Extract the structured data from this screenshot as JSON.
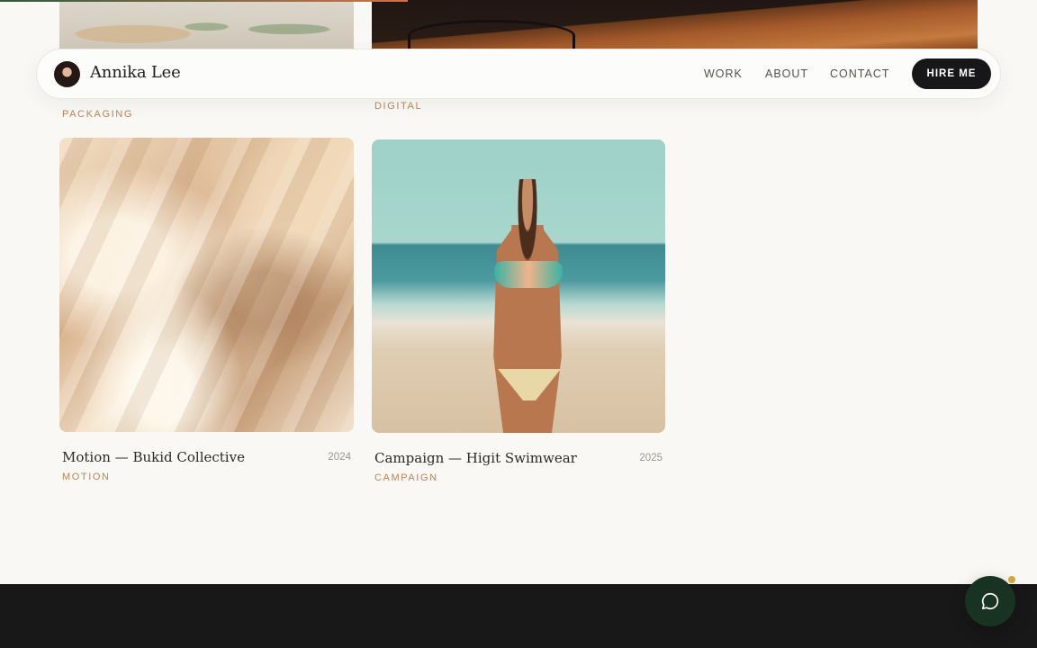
{
  "nav": {
    "brand": "Annika Lee",
    "links": [
      "WORK",
      "ABOUT",
      "CONTACT"
    ],
    "cta": "HIRE ME"
  },
  "partial_cards": [
    {
      "tag": "PACKAGING"
    },
    {
      "tag": "DIGITAL"
    }
  ],
  "cards": [
    {
      "title": "Motion — Bukid Collective",
      "year": "2024",
      "tag": "MOTION"
    },
    {
      "title": "Campaign — Higit Swimwear",
      "year": "2025",
      "tag": "CAMPAIGN"
    }
  ],
  "colors": {
    "accent": "#b98558",
    "button": "#17171a",
    "chat": "#183321",
    "footer": "#181818",
    "notification": "#d4a53a"
  },
  "icons": {
    "chat": "chat-bubble-icon"
  }
}
